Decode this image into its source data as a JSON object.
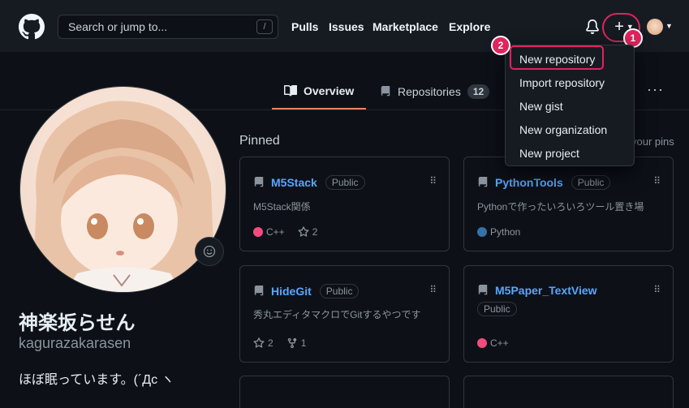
{
  "header": {
    "search_placeholder": "Search or jump to...",
    "search_shortcut": "/",
    "nav": [
      "Pulls",
      "Issues",
      "Marketplace",
      "Explore"
    ],
    "plus_label": "+"
  },
  "tabs": {
    "overview": "Overview",
    "repositories": "Repositories",
    "repositories_count": "12",
    "more": "···"
  },
  "profile": {
    "name": "神楽坂らせん",
    "login": "kagurazakarasen",
    "bio": "ほぼ眠っています。(´Дc ヽ"
  },
  "pinned": {
    "title": "Pinned",
    "customize": "your pins",
    "cards": [
      {
        "name": "M5Stack",
        "visibility": "Public",
        "description": "M5Stack関係",
        "language": "C++",
        "language_color": "#f34b7d",
        "stars": "2"
      },
      {
        "name": "PythonTools",
        "visibility": "Public",
        "description": "Pythonで作ったいろいろツール置き場",
        "language": "Python",
        "language_color": "#3572A5"
      },
      {
        "name": "HideGit",
        "visibility": "Public",
        "description": "秀丸エディタマクロでGitするやつです",
        "stars": "2",
        "forks": "1"
      },
      {
        "name": "M5Paper_TextView",
        "visibility": "Public",
        "language": "C++",
        "language_color": "#f34b7d"
      }
    ]
  },
  "dropdown": {
    "items": [
      "New repository",
      "Import repository",
      "New gist",
      "New organization",
      "New project"
    ]
  },
  "annotations": {
    "step1": "1",
    "step2": "2",
    "accent": "#e0245e"
  }
}
